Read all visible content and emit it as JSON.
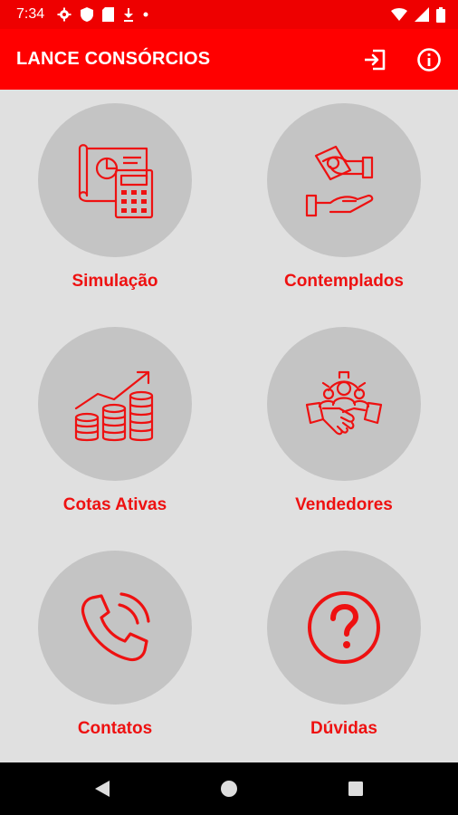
{
  "status_bar": {
    "time": "7:34"
  },
  "app_bar": {
    "title": "LANCE CONSÓRCIOS",
    "actions": [
      {
        "icon": "logout-icon"
      },
      {
        "icon": "info-icon"
      }
    ]
  },
  "menu": {
    "items": [
      {
        "label": "Simulação",
        "icon": "calculator-blueprint-icon"
      },
      {
        "label": "Contemplados",
        "icon": "hand-money-icon"
      },
      {
        "label": "Cotas Ativas",
        "icon": "coins-growth-icon"
      },
      {
        "label": "Vendedores",
        "icon": "handshake-team-icon"
      },
      {
        "label": "Contatos",
        "icon": "phone-icon"
      },
      {
        "label": "Dúvidas",
        "icon": "question-icon"
      }
    ]
  },
  "colors": {
    "primary": "#ff0000",
    "status_bar": "#ee0000",
    "background": "#e0e0e0",
    "circle": "#c4c4c4",
    "label": "#ee1111",
    "nav_bar": "#000000"
  }
}
